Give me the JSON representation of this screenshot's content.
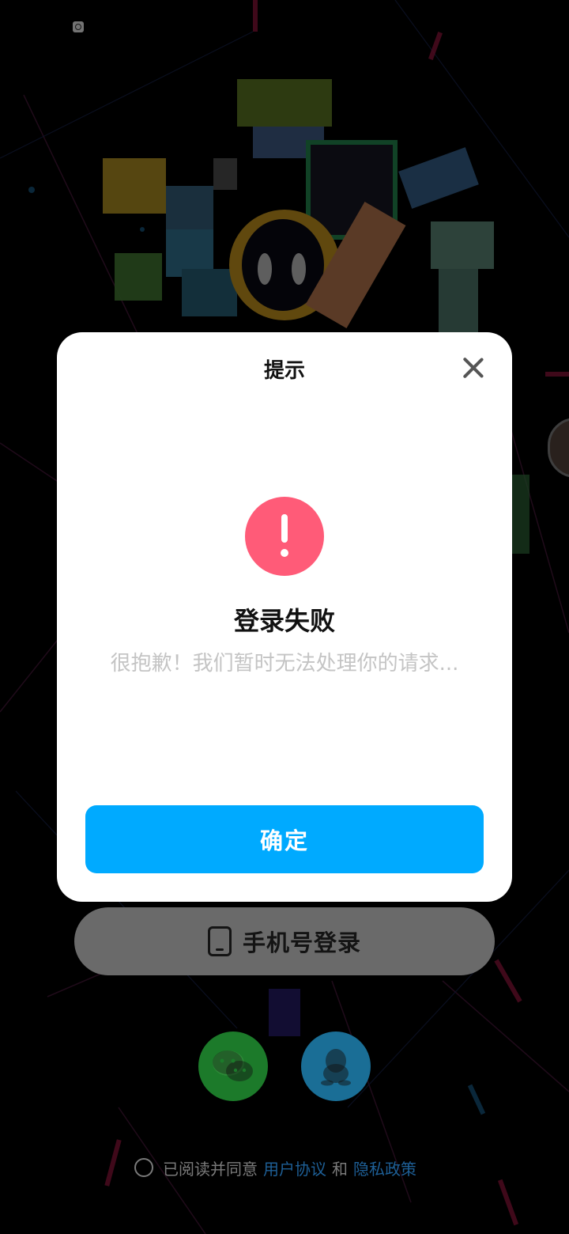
{
  "status_bar": {
    "notification_icon": "app-notification-icon"
  },
  "dialog": {
    "title": "提示",
    "close_icon": "close-icon",
    "alert_icon": "exclamation-icon",
    "heading": "登录失败",
    "message": "很抱歉！我们暂时无法处理你的请求...",
    "confirm_label": "确定"
  },
  "login": {
    "phone_label": "手机号登录",
    "phone_icon": "smartphone-icon",
    "wechat_icon": "wechat-icon",
    "qq_icon": "qq-icon"
  },
  "agreement": {
    "prefix": "已阅读并同意",
    "user_agreement": "用户协议",
    "and": "和",
    "privacy_policy": "隐私政策"
  },
  "colors": {
    "accent": "#00aaff",
    "alert": "#ff5b78",
    "link": "#1e5f96"
  }
}
